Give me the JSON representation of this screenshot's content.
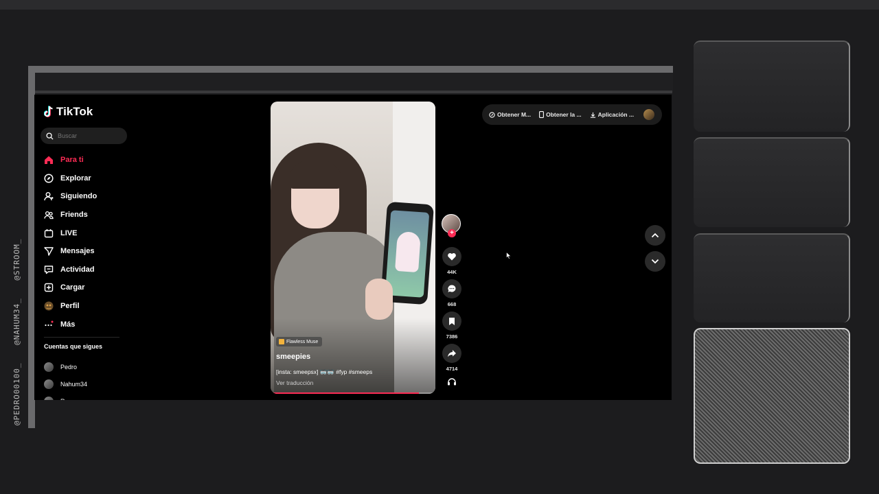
{
  "overlay": {
    "credits": [
      "@PEDRO00100_",
      "@NAHUM34_",
      "@STROOM_"
    ]
  },
  "app": {
    "name": "TikTok"
  },
  "search": {
    "placeholder": "Buscar"
  },
  "nav": {
    "items": [
      {
        "label": "Para ti",
        "icon": "home-icon",
        "active": true
      },
      {
        "label": "Explorar",
        "icon": "compass-icon"
      },
      {
        "label": "Siguiendo",
        "icon": "user-follow-icon"
      },
      {
        "label": "Friends",
        "icon": "friends-icon"
      },
      {
        "label": "LIVE",
        "icon": "live-icon"
      },
      {
        "label": "Mensajes",
        "icon": "send-icon"
      },
      {
        "label": "Actividad",
        "icon": "activity-icon"
      },
      {
        "label": "Cargar",
        "icon": "upload-icon"
      },
      {
        "label": "Perfil",
        "icon": "profile-icon"
      },
      {
        "label": "Más",
        "icon": "more-icon"
      }
    ]
  },
  "following": {
    "title": "Cuentas que sigues",
    "accounts": [
      "Pedro",
      "Nahum34",
      "Rg"
    ]
  },
  "video": {
    "effect": "Flawless Muse",
    "author": "smeepies",
    "caption": "[insta: smeepsx] 🥽🥽 #fyp #smeeps",
    "translate": "Ver traducción",
    "progress": 0.9
  },
  "actions": {
    "likes": "44K",
    "comments": "668",
    "saves": "7386",
    "shares": "4714"
  },
  "top_bar": {
    "items": [
      "Obtener M...",
      "Obtener la ...",
      "Aplicación ..."
    ]
  },
  "colors": {
    "accent": "#fe2c55",
    "background": "#000000"
  }
}
